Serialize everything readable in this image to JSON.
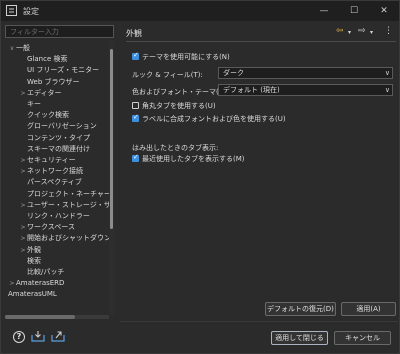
{
  "window": {
    "title": "設定"
  },
  "left": {
    "filter_placeholder": "フィルター入力",
    "tree": [
      {
        "label": "一般",
        "arrow": "∨",
        "indent": 0
      },
      {
        "label": "Glance 検索",
        "arrow": "",
        "indent": 2
      },
      {
        "label": "UI フリーズ・モニター",
        "arrow": "",
        "indent": 2
      },
      {
        "label": "Web ブラウザー",
        "arrow": "",
        "indent": 2
      },
      {
        "label": "エディター",
        "arrow": ">",
        "indent": 1
      },
      {
        "label": "キー",
        "arrow": "",
        "indent": 2
      },
      {
        "label": "クイック検索",
        "arrow": "",
        "indent": 2
      },
      {
        "label": "グローバリゼーション",
        "arrow": "",
        "indent": 2
      },
      {
        "label": "コンテンツ・タイプ",
        "arrow": "",
        "indent": 2
      },
      {
        "label": "スキーマの関連付け",
        "arrow": "",
        "indent": 2
      },
      {
        "label": "セキュリティー",
        "arrow": ">",
        "indent": 1
      },
      {
        "label": "ネットワーク接続",
        "arrow": ">",
        "indent": 1
      },
      {
        "label": "パースペクティブ",
        "arrow": "",
        "indent": 2
      },
      {
        "label": "プロジェクト・ネーチャー",
        "arrow": "",
        "indent": 2
      },
      {
        "label": "ユーザー・ストレージ・サー",
        "arrow": ">",
        "indent": 1
      },
      {
        "label": "リンク・ハンドラー",
        "arrow": "",
        "indent": 2
      },
      {
        "label": "ワークスペース",
        "arrow": ">",
        "indent": 1
      },
      {
        "label": "開始およびシャットダウン",
        "arrow": ">",
        "indent": 1
      },
      {
        "label": "外観",
        "arrow": ">",
        "indent": 1
      },
      {
        "label": "検索",
        "arrow": "",
        "indent": 2
      },
      {
        "label": "比較/パッチ",
        "arrow": "",
        "indent": 2
      },
      {
        "label": "AmaterasERD",
        "arrow": ">",
        "indent": 0
      },
      {
        "label": "AmaterasUML",
        "arrow": "",
        "indent": 0
      }
    ]
  },
  "right": {
    "page_title": "外観",
    "nav": {
      "back": "⇦",
      "back_menu": "▾",
      "forward": "⇨",
      "forward_menu": "▾",
      "more": "⋮"
    },
    "enable_theme": {
      "label": "テーマを使用可能にする(N)",
      "checked": true
    },
    "look_feel": {
      "label": "ルック & フィール(T):",
      "value": "ダーク"
    },
    "color_font_theme": {
      "label": "色およびフォント・テーマ(C):",
      "value": "デフォルト (現在)"
    },
    "rounded_tabs": {
      "label": "角丸タブを使用する(U)",
      "checked": false
    },
    "mixed_fonts": {
      "label": "ラベルに合成フォントおよび色を使用する(U)",
      "checked": true
    },
    "overflow_heading": "はみ出したときのタブ表示:",
    "recent_tabs": {
      "label": "最近使用したタブを表示する(M)",
      "checked": true
    },
    "restore_defaults": "デフォルトの復元(D)",
    "apply": "適用(A)"
  },
  "footer": {
    "help": "?",
    "apply_close": "適用して閉じる",
    "cancel": "キャンセル"
  },
  "colors": {
    "accent": "#3d8fe0",
    "background": "#2b2b2b",
    "titlebar": "#1f1f1f"
  }
}
